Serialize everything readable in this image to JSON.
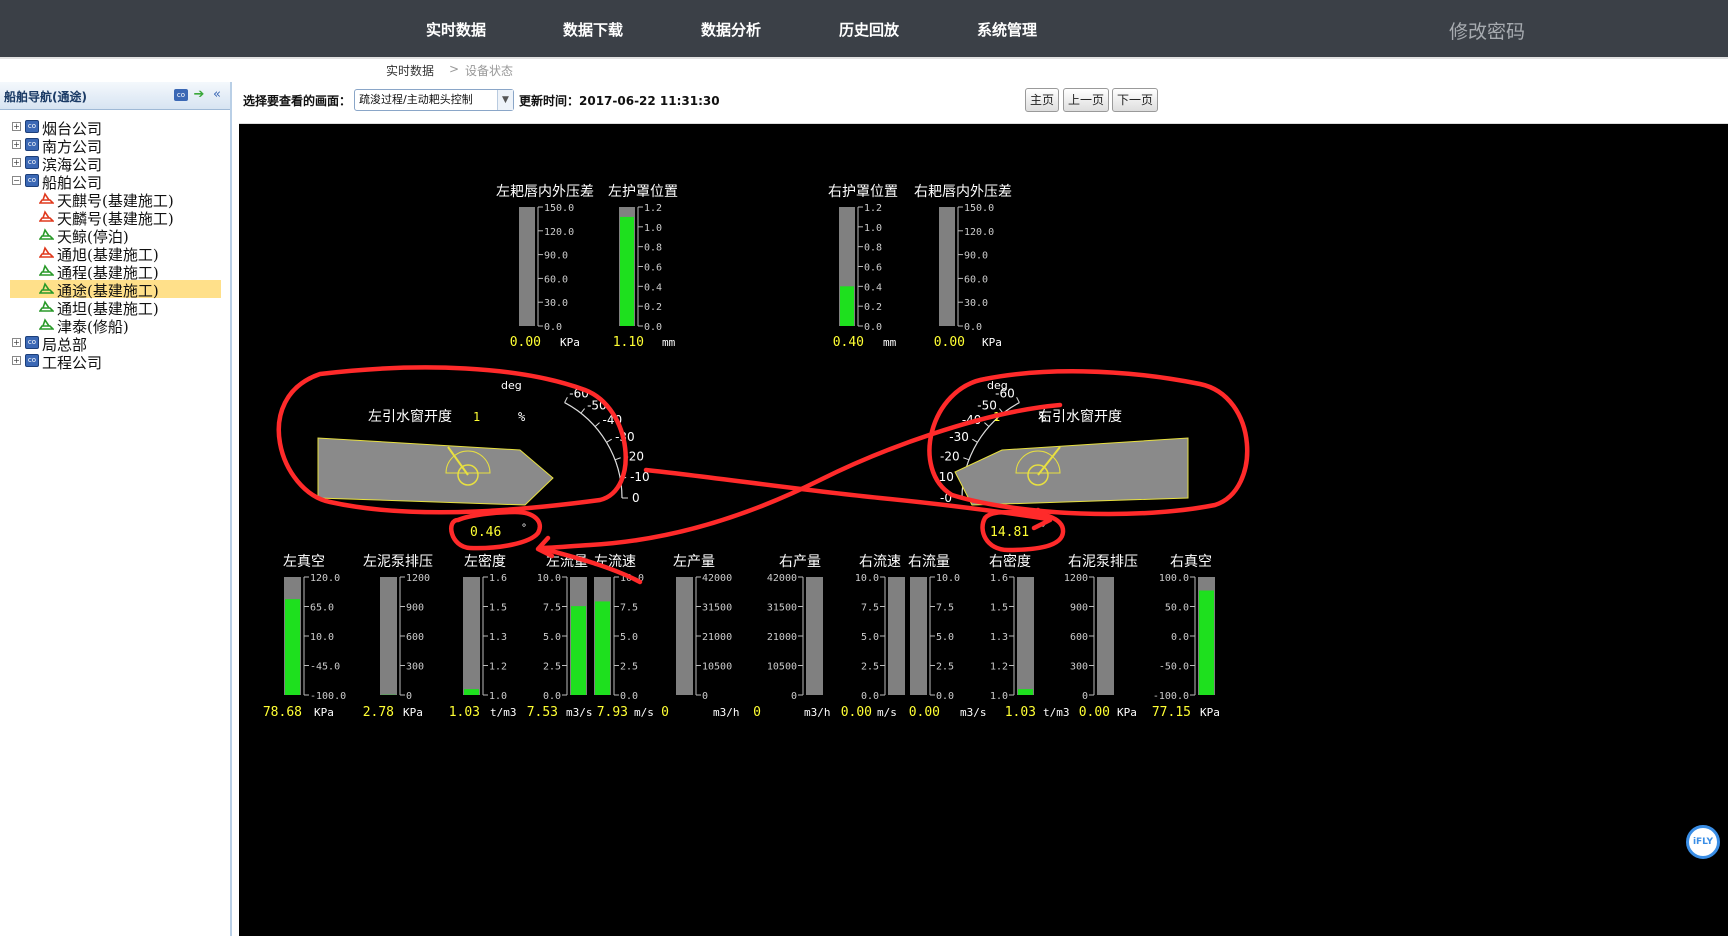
{
  "nav": {
    "items": [
      "实时数据",
      "数据下载",
      "数据分析",
      "历史回放",
      "系统管理"
    ],
    "password": "修改密码"
  },
  "breadcrumb": {
    "root": "实时数据",
    "sep": ">",
    "current": "设备状态"
  },
  "sidebar": {
    "title": "船舶导航(通途)",
    "nodes": [
      {
        "label": "烟台公司",
        "level": 0,
        "expander": "+",
        "icon": "company-icon"
      },
      {
        "label": "南方公司",
        "level": 0,
        "expander": "+",
        "icon": "company-icon"
      },
      {
        "label": "滨海公司",
        "level": 0,
        "expander": "+",
        "icon": "company-icon"
      },
      {
        "label": "船舶公司",
        "level": 0,
        "expander": "-",
        "icon": "company-icon"
      },
      {
        "label": "天麒号(基建施工)",
        "level": 1,
        "icon": "ship-red-icon"
      },
      {
        "label": "天麟号(基建施工)",
        "level": 1,
        "icon": "ship-red-icon"
      },
      {
        "label": "天鲸(停泊)",
        "level": 1,
        "icon": "ship-green-icon"
      },
      {
        "label": "通旭(基建施工)",
        "level": 1,
        "icon": "ship-red-icon"
      },
      {
        "label": "通程(基建施工)",
        "level": 1,
        "icon": "ship-green-icon"
      },
      {
        "label": "通途(基建施工)",
        "level": 1,
        "icon": "ship-green-icon",
        "selected": true
      },
      {
        "label": "通坦(基建施工)",
        "level": 1,
        "icon": "ship-green-icon"
      },
      {
        "label": "津泰(修船)",
        "level": 1,
        "icon": "ship-green-icon"
      },
      {
        "label": "局总部",
        "level": 0,
        "expander": "+",
        "icon": "company-icon"
      },
      {
        "label": "工程公司",
        "level": 0,
        "expander": "+",
        "icon": "company-icon"
      }
    ]
  },
  "toolbar": {
    "select_label": "选择要查看的画面：",
    "select_value": "疏浚过程/主动耙头控制",
    "update_time": "更新时间：2017-06-22 11:31:30",
    "buttons": [
      "主页",
      "上一页",
      "下一页"
    ]
  },
  "colors": {
    "bar_fill": "#1ee01e",
    "bar_track": "#808080",
    "value_text": "#ffff33",
    "annotation": "#ff2a2a",
    "panel_bg": "#000000"
  },
  "top_gauges": [
    {
      "title": "左耙唇内外压差",
      "ticks": [
        "150.0",
        "120.0",
        "90.0",
        "60.0",
        "30.0",
        "0.0"
      ],
      "min": 0,
      "max": 150,
      "value": 0.0,
      "value_text": "0.00",
      "unit": "KPa"
    },
    {
      "title": "左护罩位置",
      "ticks": [
        "1.2",
        "1.0",
        "0.8",
        "0.6",
        "0.4",
        "0.2",
        "0.0"
      ],
      "min": 0,
      "max": 1.2,
      "value": 1.1,
      "value_text": "1.10",
      "unit": "mm"
    },
    {
      "title": "右护罩位置",
      "ticks": [
        "1.2",
        "1.0",
        "0.8",
        "0.6",
        "0.4",
        "0.2",
        "0.0"
      ],
      "min": 0,
      "max": 1.2,
      "value": 0.4,
      "value_text": "0.40",
      "unit": "mm"
    },
    {
      "title": "右耙唇内外压差",
      "ticks": [
        "150.0",
        "120.0",
        "90.0",
        "60.0",
        "30.0",
        "0.0"
      ],
      "min": 0,
      "max": 150,
      "value": 0.0,
      "value_text": "0.00",
      "unit": "KPa"
    }
  ],
  "dials": [
    {
      "title": "左引水窗开度",
      "value_text": "1",
      "unit": "%",
      "angle_text": "0.46",
      "angle_unit": "°",
      "deg_label": "deg",
      "scale": [
        "-60",
        "-50",
        "-40",
        "-30",
        "-20",
        "-10",
        "0"
      ]
    },
    {
      "title": "右引水窗开度",
      "value_text": "1",
      "unit": "%",
      "angle_text": "14.81",
      "angle_unit": "°",
      "deg_label": "deg",
      "scale": [
        "-60",
        "-50",
        "-40",
        "-30",
        "-20",
        "-10",
        "-0"
      ]
    }
  ],
  "bottom_gauges": [
    {
      "title": "左真空",
      "ticks": [
        "120.0",
        "65.0",
        "10.0",
        "-45.0",
        "-100.0"
      ],
      "min": -100,
      "max": 120,
      "value": 78.68,
      "value_text": "78.68",
      "unit": "KPa"
    },
    {
      "title": "左泥泵排压",
      "ticks": [
        "1200",
        "900",
        "600",
        "300",
        "0"
      ],
      "min": 0,
      "max": 1200,
      "value": 2.78,
      "value_text": "2.78",
      "unit": "KPa"
    },
    {
      "title": "左密度",
      "ticks": [
        "1.6",
        "1.5",
        "1.3",
        "1.2",
        "1.0"
      ],
      "min": 1.0,
      "max": 1.6,
      "value": 1.03,
      "value_text": "1.03",
      "unit": "t/m3"
    },
    {
      "title": "左流量",
      "ticks": [
        "10.0",
        "7.5",
        "5.0",
        "2.5",
        "0.0"
      ],
      "min": 0,
      "max": 10,
      "value": 7.53,
      "value_text": "7.53",
      "unit": "m3/s"
    },
    {
      "title": "左流速",
      "ticks": [
        "10.0",
        "7.5",
        "5.0",
        "2.5",
        "0.0"
      ],
      "min": 0,
      "max": 10,
      "value": 7.93,
      "value_text": "7.93",
      "unit": "m/s"
    },
    {
      "title": "左产量",
      "ticks": [
        "42000",
        "31500",
        "21000",
        "10500",
        "0"
      ],
      "min": 0,
      "max": 42000,
      "value": 0,
      "value_text": "0",
      "unit": "m3/h"
    },
    {
      "title": "右产量",
      "ticks": [
        "42000",
        "31500",
        "21000",
        "10500",
        "0"
      ],
      "min": 0,
      "max": 42000,
      "value": 0,
      "value_text": "0",
      "unit": "m3/h"
    },
    {
      "title": "右流速",
      "ticks": [
        "10.0",
        "7.5",
        "5.0",
        "2.5",
        "0.0"
      ],
      "min": 0,
      "max": 10,
      "value": 0.0,
      "value_text": "0.00",
      "unit": "m/s"
    },
    {
      "title": "右流量",
      "ticks": [
        "10.0",
        "7.5",
        "5.0",
        "2.5",
        "0.0"
      ],
      "min": 0,
      "max": 10,
      "value": 0.0,
      "value_text": "0.00",
      "unit": "m3/s"
    },
    {
      "title": "右密度",
      "ticks": [
        "1.6",
        "1.5",
        "1.3",
        "1.2",
        "1.0"
      ],
      "min": 1.0,
      "max": 1.6,
      "value": 1.03,
      "value_text": "1.03",
      "unit": "t/m3"
    },
    {
      "title": "右泥泵排压",
      "ticks": [
        "1200",
        "900",
        "600",
        "300",
        "0"
      ],
      "min": 0,
      "max": 1200,
      "value": 0.0,
      "value_text": "0.00",
      "unit": "KPa"
    },
    {
      "title": "右真空",
      "ticks": [
        "100.0",
        "50.0",
        "0.0",
        "-50.0",
        "-100.0"
      ],
      "min": -100,
      "max": 100,
      "value": 77.15,
      "value_text": "77.15",
      "unit": "KPa"
    }
  ],
  "widget": {
    "label": "iFLY"
  }
}
